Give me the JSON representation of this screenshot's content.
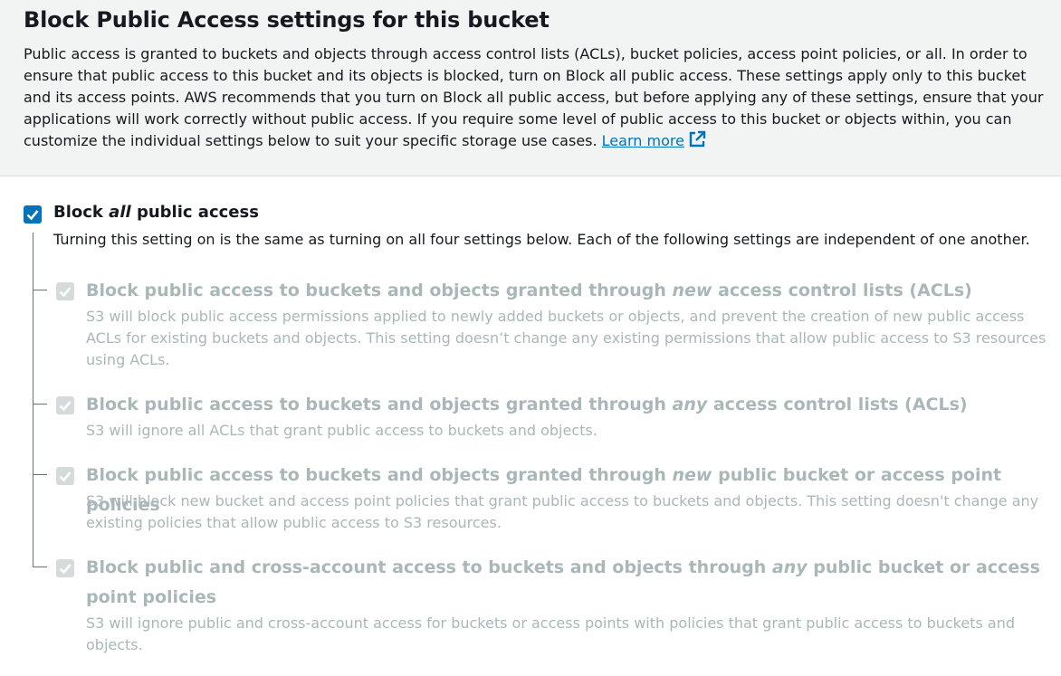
{
  "header": {
    "title": "Block Public Access settings for this bucket",
    "description": "Public access is granted to buckets and objects through access control lists (ACLs), bucket policies, access point policies, or all. In order to ensure that public access to this bucket and its objects is blocked, turn on Block all public access. These settings apply only to this bucket and its access points. AWS recommends that you turn on Block all public access, but before applying any of these settings, ensure that your applications will work correctly without public access. If you require some level of public access to this bucket or objects within, you can customize the individual settings below to suit your specific storage use cases.",
    "learn_more": "Learn more",
    "external_link_icon": "external-link-icon"
  },
  "block_all": {
    "label_pre": "Block ",
    "label_em": "all",
    "label_post": " public access",
    "checked": true,
    "description": "Turning this setting on is the same as turning on all four settings below. Each of the following settings are independent of one another."
  },
  "options": [
    {
      "label_pre": "Block public access to buckets and objects granted through ",
      "label_em": "new",
      "label_post": " access control lists (ACLs)",
      "description": "S3 will block public access permissions applied to newly added buckets or objects, and prevent the creation of new public access ACLs for existing buckets and objects. This setting doesn’t change any existing permissions that allow public access to S3 resources using ACLs.",
      "checked": true,
      "disabled": true
    },
    {
      "label_pre": "Block public access to buckets and objects granted through ",
      "label_em": "any",
      "label_post": " access control lists (ACLs)",
      "description": "S3 will ignore all ACLs that grant public access to buckets and objects.",
      "checked": true,
      "disabled": true
    },
    {
      "label_pre": "Block public access to buckets and objects granted through ",
      "label_em": "new",
      "label_post": " public bucket or access point policies",
      "description": "S3 will block new bucket and access point policies that grant public access to buckets and objects. This setting doesn't change any existing policies that allow public access to S3 resources.",
      "checked": true,
      "disabled": true
    },
    {
      "label_pre": "Block public and cross-account access to buckets and objects through ",
      "label_em": "any",
      "label_post": " public bucket or access point policies",
      "description": "S3 will ignore public and cross-account access for buckets or access points with policies that grant public access to buckets and objects.",
      "checked": true,
      "disabled": true
    }
  ],
  "colors": {
    "link": "#0073bb",
    "checkbox_active": "#0073bb",
    "checkbox_disabled": "#d5dbdb",
    "disabled_text": "#aab7b8"
  }
}
